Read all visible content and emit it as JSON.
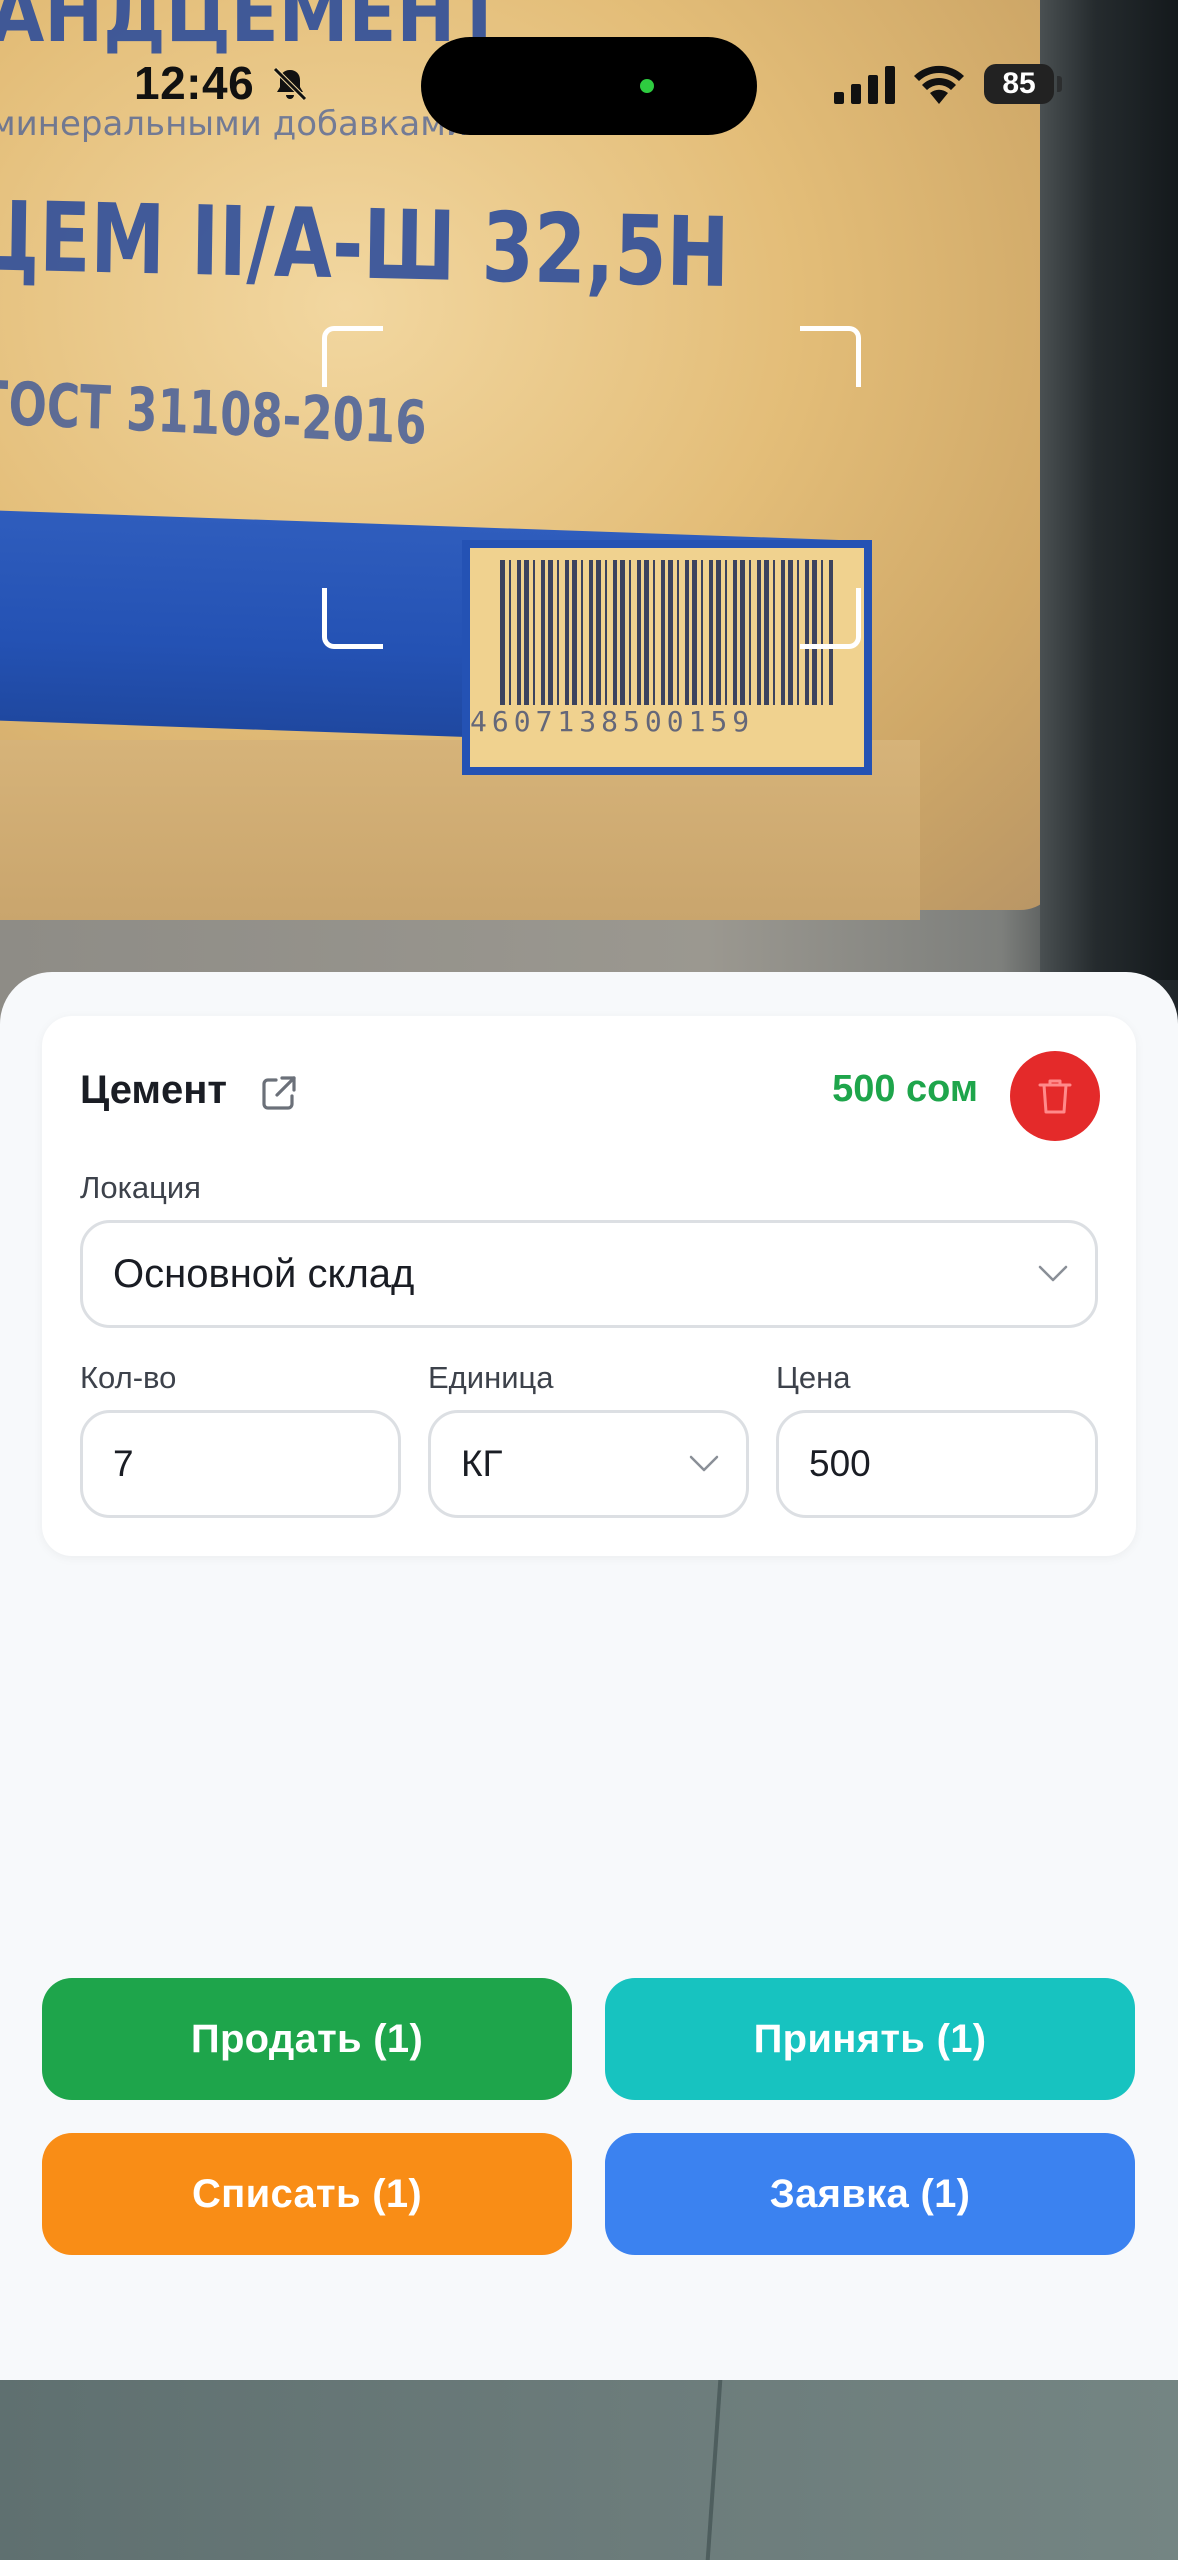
{
  "status_bar": {
    "time": "12:46",
    "battery": "85",
    "icons": [
      "bell-slash-icon",
      "cellular-signal-icon",
      "wifi-icon",
      "battery-icon"
    ]
  },
  "camera": {
    "printed_line1": "АНДЦЕМЕНТ",
    "printed_line2": "минеральными добавками",
    "printed_line3": "ЦЕМ II/А-Ш  32,5Н",
    "printed_line4": "ГОСТ 31108-2016",
    "barcode_digits": "4607138500159"
  },
  "product": {
    "name": "Цемент",
    "price": "500 сом"
  },
  "location": {
    "label": "Локация",
    "value": "Основной склад"
  },
  "quantity": {
    "label": "Кол-во",
    "value": "7"
  },
  "unit": {
    "label": "Единица",
    "value": "КГ"
  },
  "price": {
    "label": "Цена",
    "value": "500"
  },
  "actions": {
    "sell": "Продать (1)",
    "receive": "Принять (1)",
    "write_off": "Списать (1)",
    "request": "Заявка (1)"
  },
  "colors": {
    "sell": "#1ea54b",
    "receive": "#17c3c0",
    "write_off": "#f98d16",
    "request": "#3b82f0",
    "delete": "#e42a2a",
    "price_text": "#1ea54b"
  }
}
